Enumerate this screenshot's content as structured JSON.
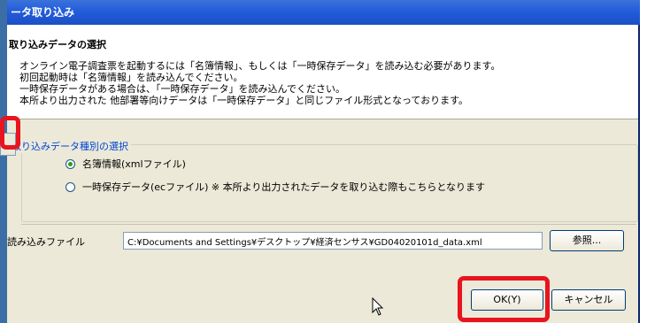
{
  "dialog": {
    "title": "ータ取り込み"
  },
  "section": {
    "title": "取り込みデータの選択",
    "lines": [
      "オンライン電子調査票を起動するには「名簿情報」、もしくは「一時保存データ」を読み込む必要があります。",
      "初回起動時は「名簿情報」を読み込んでください。",
      "一時保存データがある場合は、「一時保存データ」を読み込んでください。",
      "本所より出力された 他部署等向けデータは「一時保存データ」と同じファイル形式となっております。"
    ]
  },
  "group": {
    "label": "取り込みデータ種別の選択",
    "options": [
      {
        "label": "名簿情報(xmlファイル)",
        "selected": true
      },
      {
        "label": "一時保存データ(ecファイル)   ※ 本所より出力されたデータを取り込む際もこちらとなります",
        "selected": false
      }
    ]
  },
  "file": {
    "label": "読み込みファイル",
    "value": "C:¥Documents and Settings¥デスクトップ¥経済センサス¥GD04020101d_data.xml",
    "browse_label": "参照..."
  },
  "buttons": {
    "ok": "OK(Y)",
    "cancel": "キャンセル"
  },
  "colors": {
    "highlight": "#e8141e",
    "titlebar": "#245edc",
    "group_label": "#0046d5"
  }
}
